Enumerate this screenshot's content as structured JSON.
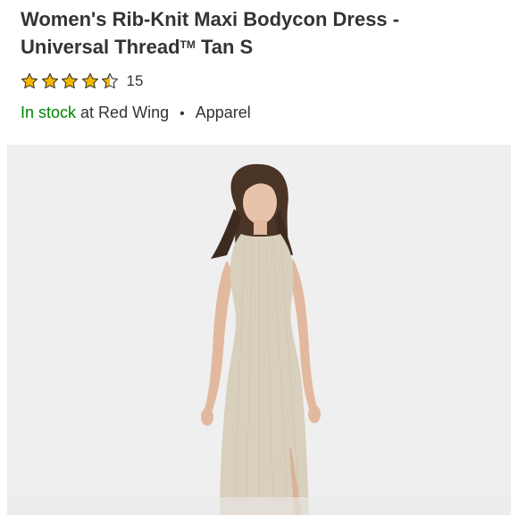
{
  "product": {
    "title_line1": "Women's Rib-Knit Maxi Bodycon Dress -",
    "title_line2_brand": "Universal Thread",
    "title_tm": "TM",
    "title_line2_rest": " Tan S",
    "rating": 4.5,
    "rating_max": 5,
    "review_count": "15",
    "availability": {
      "status": "In stock",
      "store_text": "at Red Wing",
      "bullet": "•",
      "category": "Apparel"
    },
    "image": {
      "name": "product-photo"
    }
  },
  "colors": {
    "star": "#f5b800",
    "in_stock": "#008300",
    "text": "#333333",
    "image_bg": "#efefef",
    "dress": "#d9cfbd"
  }
}
